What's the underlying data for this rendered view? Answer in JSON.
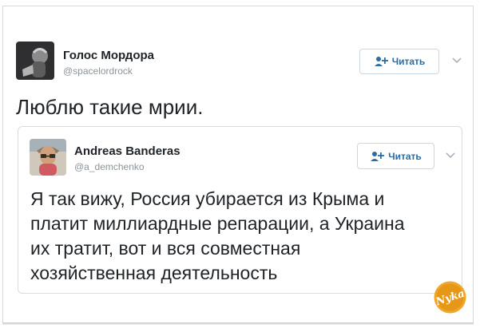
{
  "tweet": {
    "author": {
      "display_name": "Голос Мордора",
      "handle": "@spacelordrock",
      "avatar_icon": "profile-photo-dark"
    },
    "follow_button": {
      "label": "Читать",
      "icon": "add-user-icon"
    },
    "more_icon": "chevron-down-icon",
    "text": "Люблю такие мрии."
  },
  "quoted_tweet": {
    "author": {
      "display_name": "Andreas Banderas",
      "handle": "@a_demchenko",
      "avatar_icon": "profile-photo-hat"
    },
    "follow_button": {
      "label": "Читать",
      "icon": "add-user-icon"
    },
    "more_icon": "chevron-down-icon",
    "text_lines": [
      "Я так вижу, Россия убирается из Крыма и",
      "платит миллиардные репарации, а Украина",
      "их тратит, вот и вся совместная",
      "хозяйственная деятельность"
    ]
  },
  "watermark": {
    "text": "Nyka",
    "colors": {
      "fill": "#f0a62a",
      "text": "#ffffff"
    }
  },
  "colors": {
    "follow_text": "#2b6ca3",
    "follow_border": "#c9d8e5",
    "text_primary": "#1f2328",
    "text_secondary": "#8b949b"
  }
}
